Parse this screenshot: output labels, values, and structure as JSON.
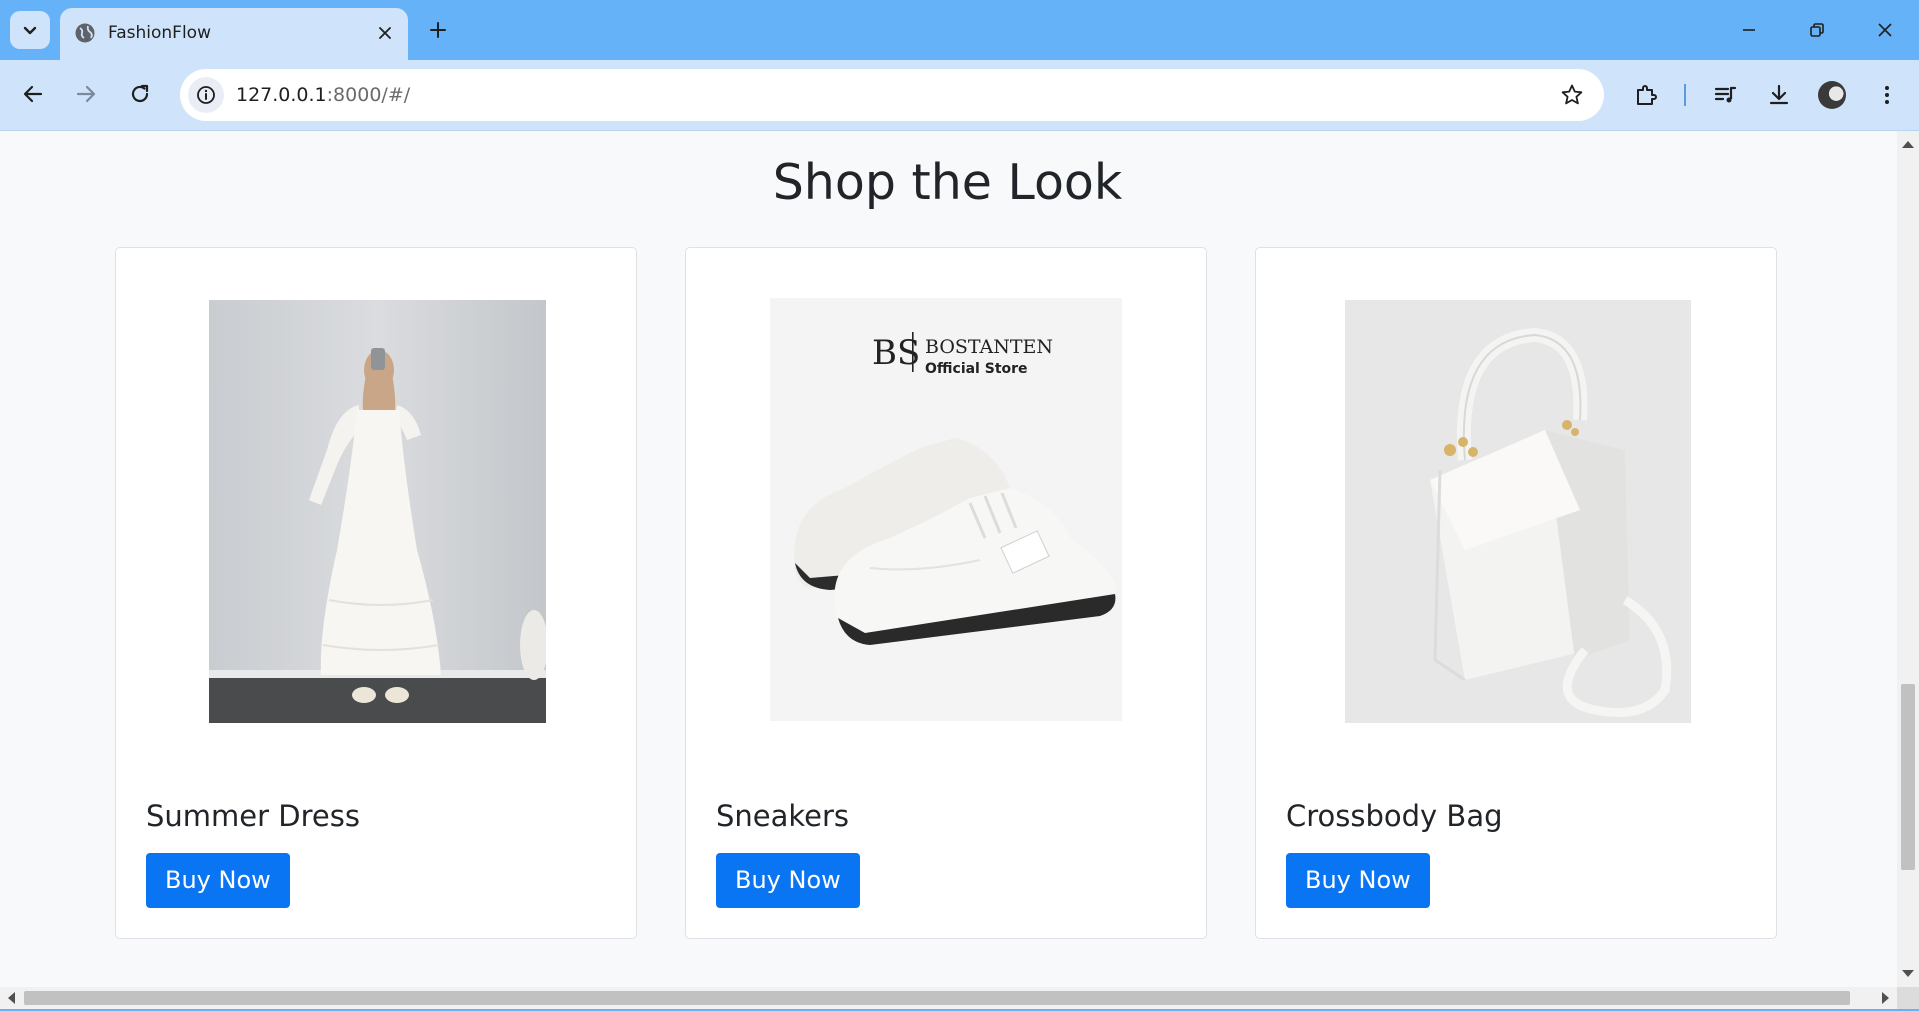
{
  "browser": {
    "tab_title": "FashionFlow",
    "url_host": "127.0.0.1",
    "url_path": ":8000/#/"
  },
  "page": {
    "section_title": "Shop the Look",
    "products": [
      {
        "name": "Summer Dress",
        "button_label": "Buy Now",
        "image": "white-maxi-dress-photo"
      },
      {
        "name": "Sneakers",
        "button_label": "Buy Now",
        "image": "white-sneakers-photo",
        "brand_mark": "BS",
        "brand_name": "BOSTANTEN",
        "brand_sub": "Official Store"
      },
      {
        "name": "Crossbody Bag",
        "button_label": "Buy Now",
        "image": "white-crossbody-bag-photo"
      }
    ]
  },
  "colors": {
    "accent": "#0a75f3",
    "chrome": "#66b2f8",
    "chrome_light": "#cfe4fb",
    "page_bg": "#f8f9fa"
  }
}
